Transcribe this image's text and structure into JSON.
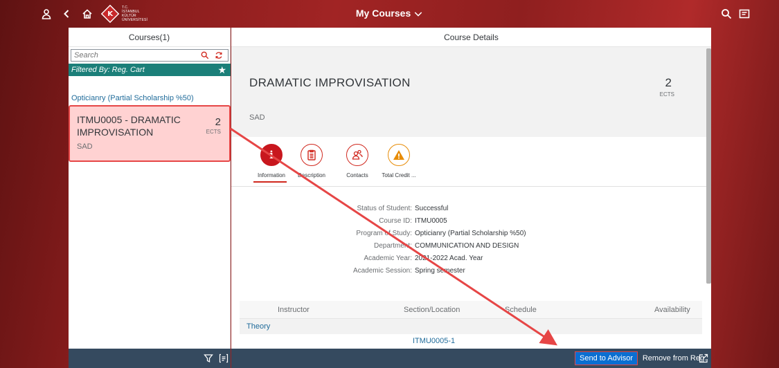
{
  "shell": {
    "title": "My Courses",
    "logo_lines": [
      "T.C.",
      "İSTANBUL",
      "KÜLTÜR",
      "ÜNİVERSİTESİ"
    ],
    "logo_letter": "K",
    "icons": [
      "user-icon",
      "back-icon",
      "home-icon",
      "search-icon",
      "menu-icon"
    ]
  },
  "master": {
    "header": "Courses(1)",
    "search_placeholder": "Search",
    "filter_text": "Filtered By: Reg. Cart",
    "program": "Opticianry (Partial Scholarship %50)",
    "course": {
      "title": "ITMU0005 - DRAMATIC IMPROVISATION",
      "credits": "2",
      "credit_unit": "ECTS",
      "subtitle": "SAD"
    }
  },
  "detail": {
    "header": "Course Details",
    "title": "DRAMATIC IMPROVISATION",
    "subtitle": "SAD",
    "credits": "2",
    "credit_unit": "ECTS",
    "tabs": [
      {
        "label": "Information",
        "icon": "info-icon",
        "active": true
      },
      {
        "label": "Description",
        "icon": "document-icon",
        "active": false
      },
      {
        "label": "Contacts",
        "icon": "contacts-icon",
        "active": false
      },
      {
        "label": "Total Credit ...",
        "icon": "warning-icon",
        "active": false
      }
    ],
    "fields": [
      {
        "key": "Status of Student:",
        "value": "Successful"
      },
      {
        "key": "Course ID:",
        "value": "ITMU0005"
      },
      {
        "key": "Program of Study:",
        "value": "Opticianry (Partial Scholarship %50)"
      },
      {
        "key": "Department:",
        "value": "COMMUNICATION AND DESIGN"
      },
      {
        "key": "Academic Year:",
        "value": "2021-2022 Acad. Year"
      },
      {
        "key": "Academic Session:",
        "value": "Spring semester"
      }
    ],
    "table": {
      "columns": [
        "Instructor",
        "Section/Location",
        "Schedule",
        "Availability"
      ],
      "group": "Theory",
      "rows": [
        {
          "section": "ITMU0005-1"
        }
      ]
    }
  },
  "footer": {
    "send_label": "Send to Advisor",
    "remove_label": "Remove from Reg. Cart"
  },
  "colors": {
    "accent": "#d0271d",
    "filter_bar": "#1b7f79",
    "footer": "#354a5f",
    "emphasized_button": "#0a6ed1",
    "annotation": "#e64646"
  }
}
